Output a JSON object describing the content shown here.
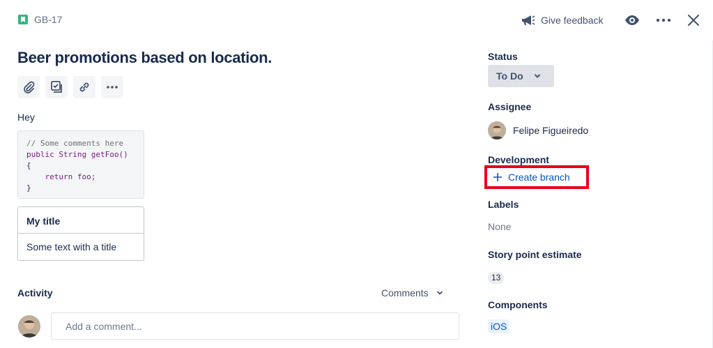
{
  "header": {
    "issue_key": "GB-17",
    "feedback_label": "Give feedback"
  },
  "issue": {
    "title": "Beer promotions based on location.",
    "description": "Hey",
    "code_lines": [
      "// Some comments here",
      "public String getFoo()",
      "{",
      "    return foo;",
      "}"
    ],
    "panel": {
      "title": "My title",
      "body": "Some text with a title"
    }
  },
  "activity": {
    "label": "Activity",
    "filter_value": "Comments",
    "comment_placeholder": "Add a comment..."
  },
  "sidebar": {
    "status_label": "Status",
    "status_value": "To Do",
    "assignee_label": "Assignee",
    "assignee_name": "Felipe Figueiredo",
    "development_label": "Development",
    "create_branch_label": "Create branch",
    "labels_label": "Labels",
    "labels_value": "None",
    "story_points_label": "Story point estimate",
    "story_points_value": "13",
    "components_label": "Components",
    "component_value": "iOS"
  },
  "colors": {
    "issue_type": "#36b37e",
    "link": "#0052cc",
    "highlight": "#e8001c"
  }
}
